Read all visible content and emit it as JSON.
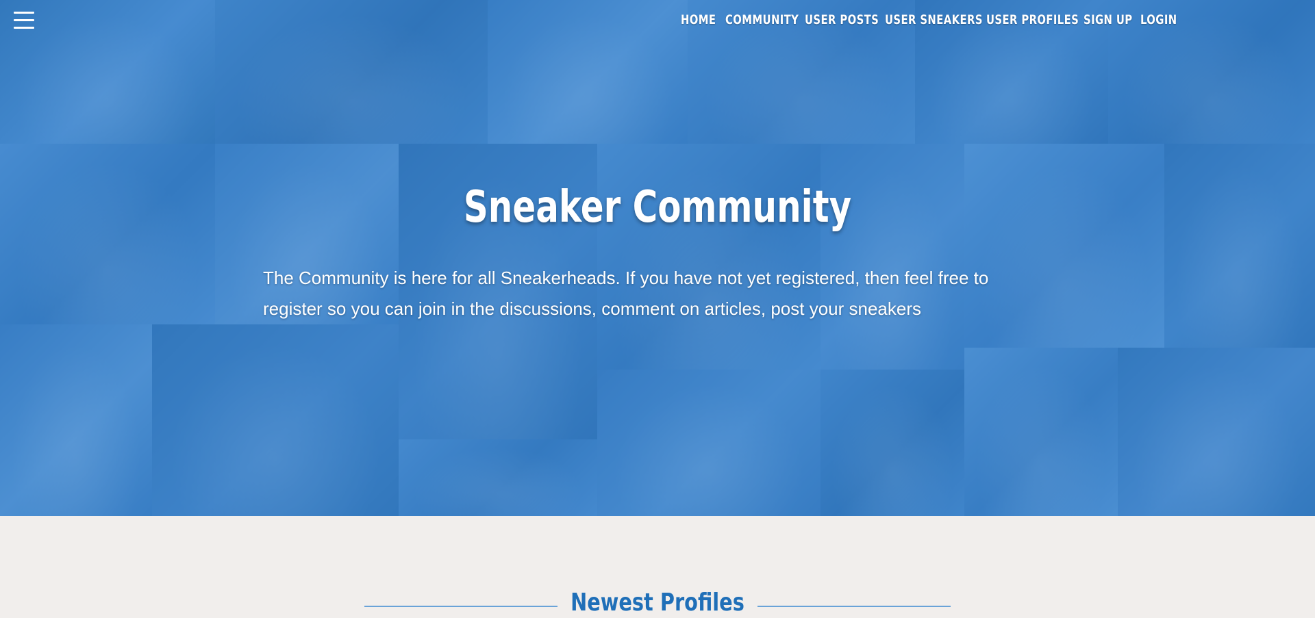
{
  "nav": {
    "menu_icon": "hamburger-icon",
    "items": [
      {
        "label": "HOME"
      },
      {
        "label": "COMMUNITY"
      },
      {
        "label": "USER POSTS"
      },
      {
        "label": "USER SNEAKERS"
      },
      {
        "label": "USER PROFILES"
      },
      {
        "label": "SIGN UP"
      },
      {
        "label": "LOGIN"
      }
    ]
  },
  "hero": {
    "title": "Sneaker Community",
    "text": "The Community is here for all Sneakerheads. If you have not yet registered, then feel free to register so you can join in the discussions, comment on articles, post your sneakers",
    "overlay_color": "#3a82c8"
  },
  "section": {
    "title": "Newest Profiles",
    "accent_color": "#1f6fb8"
  },
  "colors": {
    "page_bg": "#f1eeec",
    "text_on_hero": "#ffffff"
  }
}
